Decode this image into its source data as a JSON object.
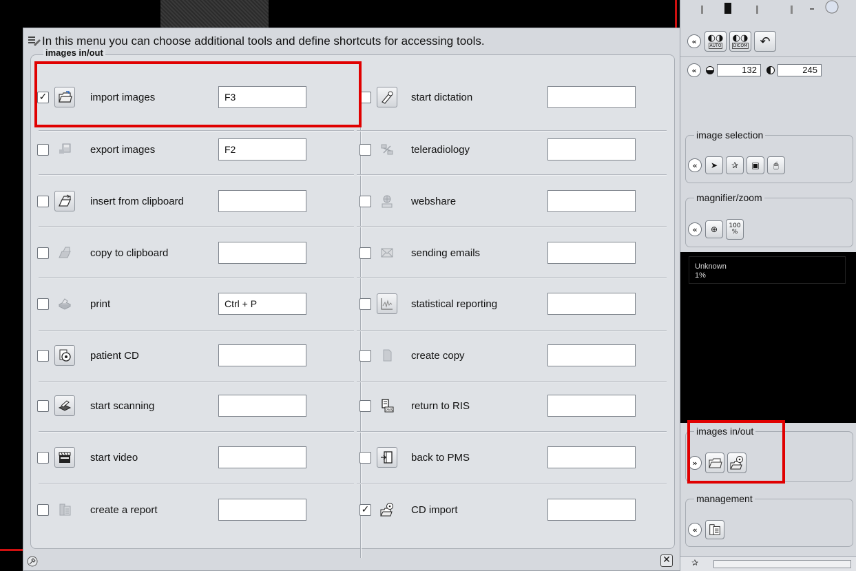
{
  "dialog": {
    "header_text": "In this menu you can choose additional tools and define shortcuts for accessing tools.",
    "group_title": "images in/out",
    "left_tools": [
      {
        "label": "import images",
        "shortcut": "F3",
        "checked": "✓",
        "icon": "open-folder-icon"
      },
      {
        "label": "export images",
        "shortcut": "F2",
        "checked": "",
        "icon": "floppy-disk-icon"
      },
      {
        "label": "insert from clipboard",
        "shortcut": "",
        "checked": "",
        "icon": "clipboard-paste-icon"
      },
      {
        "label": "copy to clipboard",
        "shortcut": "",
        "checked": "",
        "icon": "clipboard-copy-icon"
      },
      {
        "label": "print",
        "shortcut": "Ctrl + P",
        "checked": "",
        "icon": "printer-icon"
      },
      {
        "label": "patient CD",
        "shortcut": "",
        "checked": "",
        "icon": "cd-icon"
      },
      {
        "label": "start scanning",
        "shortcut": "",
        "checked": "",
        "icon": "scanner-icon"
      },
      {
        "label": "start video",
        "shortcut": "",
        "checked": "",
        "icon": "video-clapper-icon"
      },
      {
        "label": "create a report",
        "shortcut": "",
        "checked": "",
        "icon": "report-icon"
      }
    ],
    "right_tools": [
      {
        "label": "start dictation",
        "shortcut": "",
        "checked": "",
        "icon": "microphone-icon"
      },
      {
        "label": "teleradiology",
        "shortcut": "",
        "checked": "",
        "icon": "teleradiology-icon"
      },
      {
        "label": "webshare",
        "shortcut": "",
        "checked": "",
        "icon": "www-globe-icon"
      },
      {
        "label": "sending emails",
        "shortcut": "",
        "checked": "",
        "icon": "envelope-icon"
      },
      {
        "label": "statistical reporting",
        "shortcut": "",
        "checked": "",
        "icon": "statistics-chart-icon"
      },
      {
        "label": "create copy",
        "shortcut": "",
        "checked": "",
        "icon": "document-copy-icon"
      },
      {
        "label": "return to RIS",
        "shortcut": "",
        "checked": "",
        "icon": "pms-return-icon"
      },
      {
        "label": "back to PMS",
        "shortcut": "",
        "checked": "",
        "icon": "exit-door-icon"
      },
      {
        "label": "CD import",
        "shortcut": "",
        "checked": "✓",
        "icon": "cd-import-folder-icon"
      }
    ],
    "close_glyph": "✕"
  },
  "sidebar": {
    "auto_label": "AUTO",
    "dicom_label": "DICOM",
    "window_center": "132",
    "window_width": "245",
    "collapse_glyph": "«",
    "expand_glyph": "»",
    "image_selection_title": "image selection",
    "magnifier_title": "magnifier/zoom",
    "zoom_100_label": "100\n%",
    "info_line1": "Unknown",
    "info_line2": "1%",
    "images_inout_title": "images in/out",
    "management_title": "management"
  },
  "colors": {
    "highlight_red": "#e00000",
    "panel_bg": "#d6d9de"
  }
}
